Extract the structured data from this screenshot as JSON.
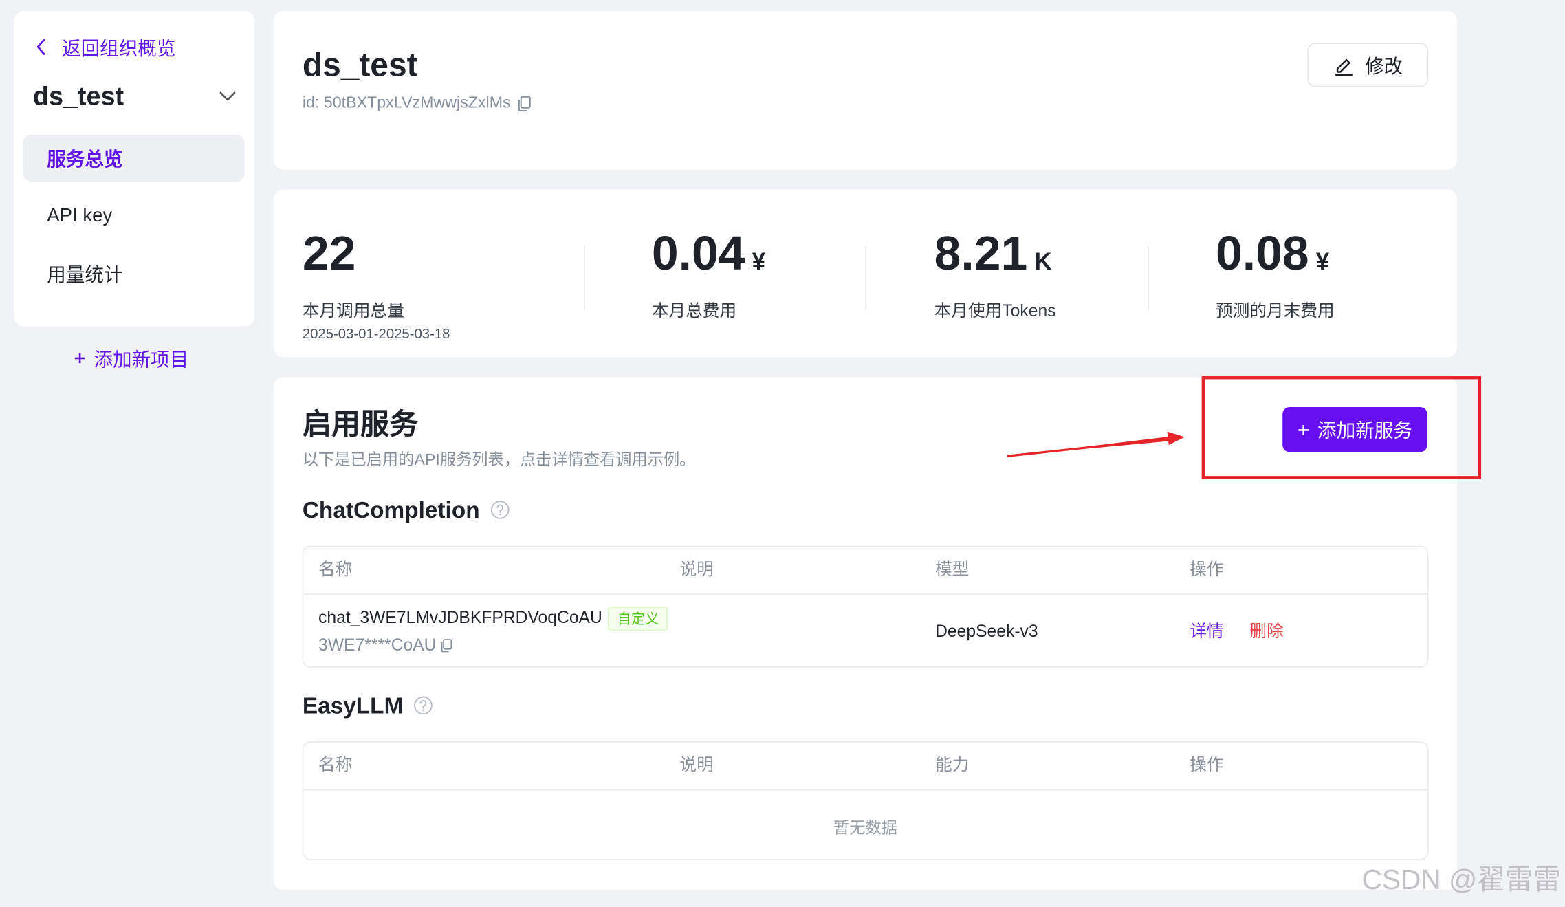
{
  "sidebar": {
    "back_label": "返回组织概览",
    "project_name": "ds_test",
    "nav": [
      {
        "label": "服务总览",
        "active": true
      },
      {
        "label": "API key",
        "active": false
      },
      {
        "label": "用量统计",
        "active": false
      }
    ],
    "add_project_label": "添加新项目"
  },
  "header": {
    "title": "ds_test",
    "id_label": "id: 50tBXTpxLVzMwwjsZxlMs",
    "edit_label": "修改"
  },
  "stats": [
    {
      "value": "22",
      "label": "本月调用总量",
      "sub": "2025-03-01-2025-03-18"
    },
    {
      "value": "0.04",
      "unit": "¥",
      "label": "本月总费用"
    },
    {
      "value": "8.21",
      "unit": "K",
      "label": "本月使用Tokens"
    },
    {
      "value": "0.08",
      "unit": "¥",
      "label": "预测的月末费用"
    }
  ],
  "services": {
    "title": "启用服务",
    "subtitle": "以下是已启用的API服务列表，点击详情查看调用示例。",
    "add_label": "添加新服务",
    "chat_completion": {
      "title": "ChatCompletion",
      "columns": [
        "名称",
        "说明",
        "模型",
        "操作"
      ],
      "rows": [
        {
          "name": "chat_3WE7LMvJDBKFPRDVoqCoAU",
          "tag": "自定义",
          "key": "3WE7****CoAU",
          "model": "DeepSeek-v3",
          "actions": [
            "详情",
            "删除"
          ]
        }
      ]
    },
    "easyllm": {
      "title": "EasyLLM",
      "columns": [
        "名称",
        "说明",
        "能力",
        "操作"
      ],
      "empty_text": "暂无数据"
    }
  },
  "colors": {
    "accent": "#6610f2",
    "link": "#6216e8",
    "danger": "#e5484d",
    "annotation": "#e5252a",
    "tag_green": "#52c41a"
  },
  "watermark": "CSDN @翟雷雷"
}
